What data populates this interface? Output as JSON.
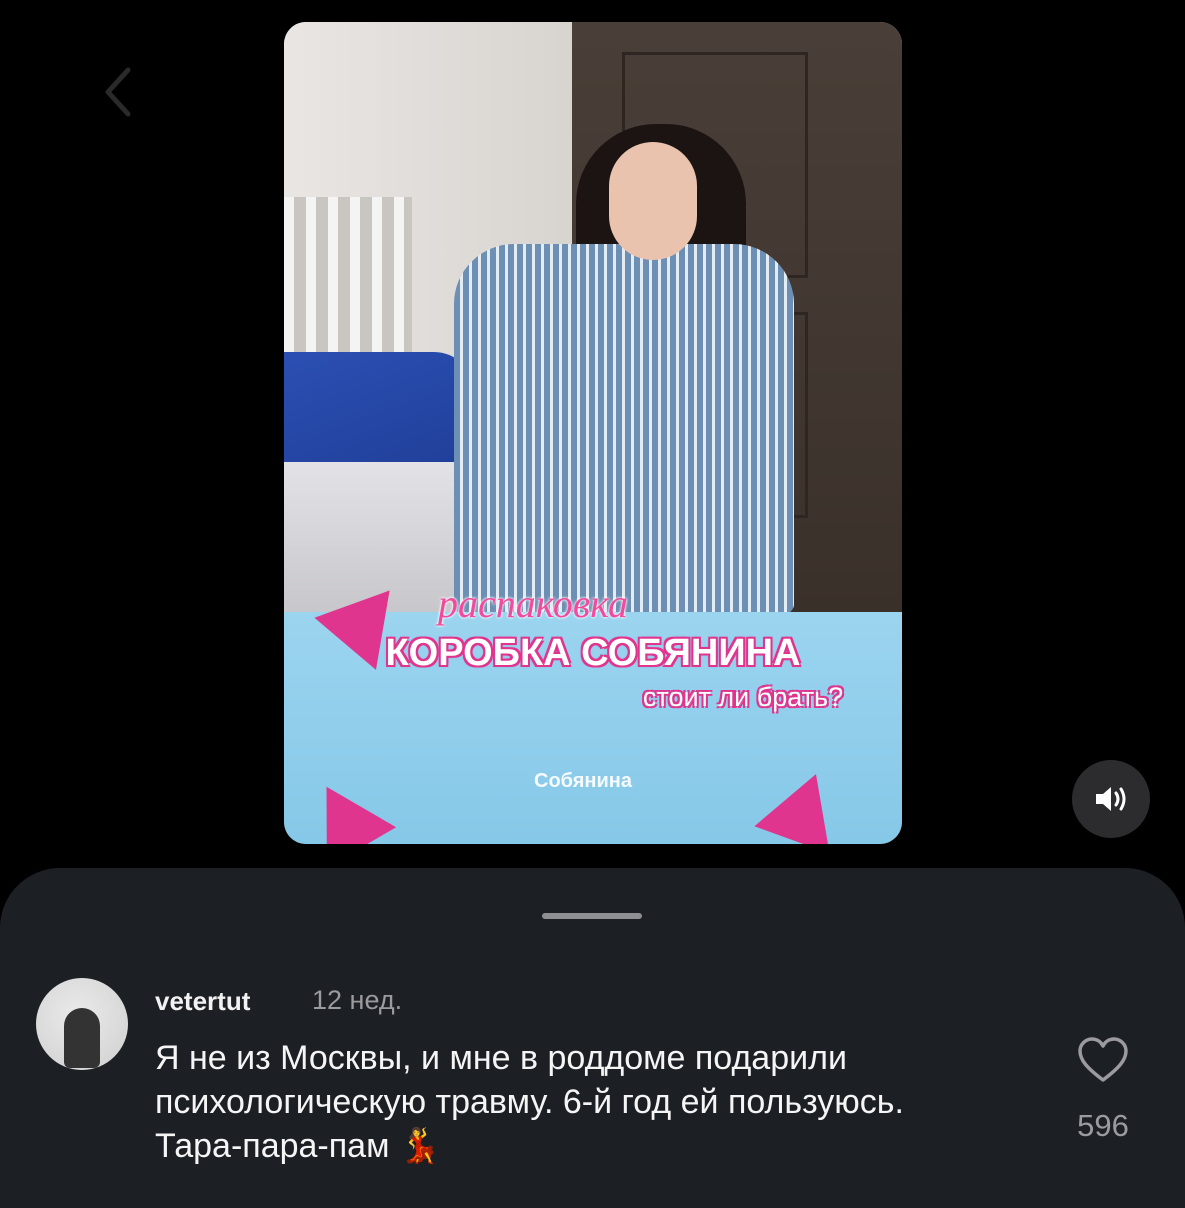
{
  "video": {
    "caption_small": "распаковка",
    "caption_title": "КОРОБКА СОБЯНИНА",
    "caption_question": "стоит ли брать?",
    "box_brand": "Собянина"
  },
  "controls": {
    "back_icon": "chevron-left-icon",
    "sound_icon": "speaker-icon"
  },
  "comment": {
    "username": "vetertut",
    "time": "12 нед.",
    "text": "Я не из Москвы, и мне в роддоме подарили психологическую травму. 6-й год ей пользуюсь. Тара-пара-пам 💃",
    "likes": "596",
    "like_icon": "heart-icon"
  },
  "colors": {
    "background": "#000000",
    "sheet": "#1c1f24",
    "accent_pink": "#e0358f",
    "muted": "#9a9a9f"
  }
}
